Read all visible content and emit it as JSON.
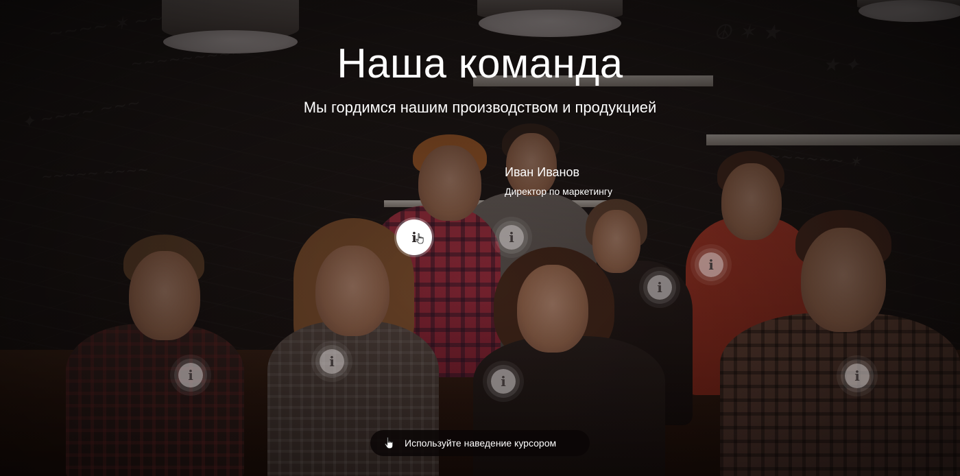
{
  "page": {
    "title": "Наша команда",
    "subtitle": "Мы гордимся нашим производством и продукцией"
  },
  "active_member": {
    "name": "Иван Иванов",
    "role": "Директор по маркетингу"
  },
  "hotspots": [
    {
      "id": "member-1",
      "glyph": "i",
      "active": true
    },
    {
      "id": "member-2",
      "glyph": "i",
      "active": false
    },
    {
      "id": "member-3",
      "glyph": "i",
      "active": false
    },
    {
      "id": "member-4",
      "glyph": "i",
      "active": false
    },
    {
      "id": "member-5",
      "glyph": "i",
      "active": false
    },
    {
      "id": "member-6",
      "glyph": "i",
      "active": false
    },
    {
      "id": "member-7",
      "glyph": "i",
      "active": false
    },
    {
      "id": "member-8",
      "glyph": "i",
      "active": false
    }
  ],
  "hint": {
    "icon": "hand-pointer-icon",
    "text": "Используйте наведение курсором"
  },
  "colors": {
    "text": "#ffffff",
    "hotspot_idle": "#dcd7d7",
    "hotspot_active": "#ffffff",
    "hint_background": "#0a0606"
  }
}
